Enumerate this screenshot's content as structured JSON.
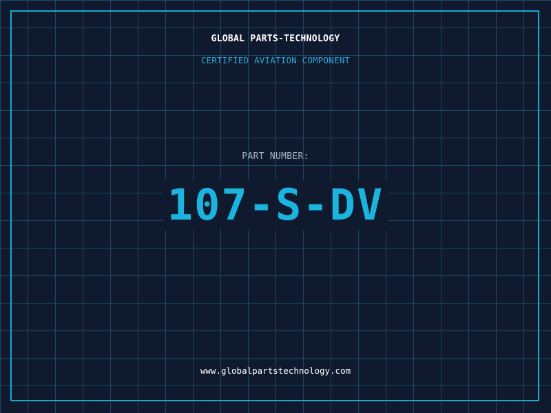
{
  "header": {
    "company": "GLOBAL PARTS-TECHNOLOGY",
    "subtitle": "CERTIFIED AVIATION COMPONENT"
  },
  "part": {
    "label": "PART NUMBER:",
    "number": "107-S-DV"
  },
  "footer": {
    "website": "www.globalpartstechnology.com"
  },
  "colors": {
    "background": "#0f1a2e",
    "accent": "#1ab4de",
    "grid": "#286e8c"
  }
}
